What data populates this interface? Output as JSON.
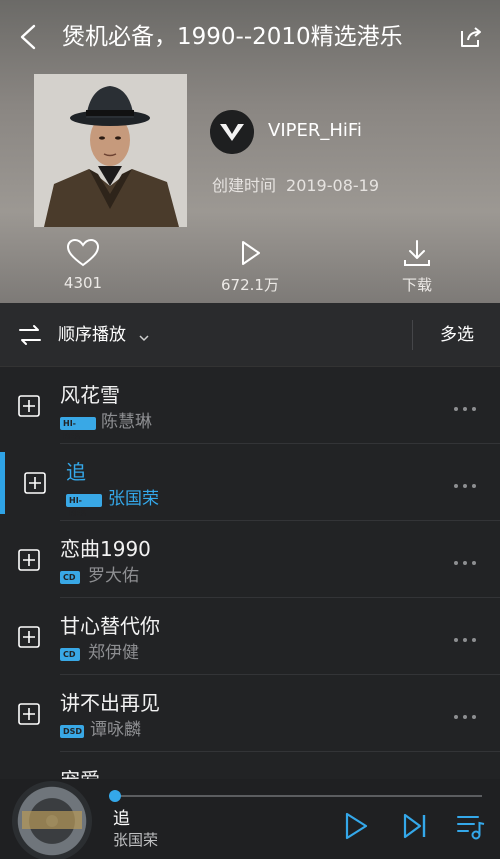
{
  "header": {
    "title": "煲机必备，1990--2010精选港乐",
    "creator": "VIPER_HiFi",
    "created_label": "创建时间",
    "created_date": "2019-08-19",
    "cover_desc": "Album cover photo of a man in a dark hat and coat"
  },
  "actions": {
    "like": "4301",
    "play": "672.1万",
    "download": "下载"
  },
  "controls": {
    "play_order": "顺序播放",
    "multi_select": "多选"
  },
  "songs": [
    {
      "title": "风花雪",
      "badge": "HI-RES",
      "artist": "陈慧琳"
    },
    {
      "title": "追",
      "badge": "HI-RES",
      "artist": "张国荣",
      "active": true
    },
    {
      "title": "恋曲1990",
      "badge": "CD",
      "artist": "罗大佑"
    },
    {
      "title": "甘心替代你",
      "badge": "CD",
      "artist": "郑伊健"
    },
    {
      "title": "讲不出再见",
      "badge": "DSD",
      "artist": "谭咏麟"
    },
    {
      "title": "宠爱",
      "partial": true
    }
  ],
  "player": {
    "title": "追",
    "artist": "张国荣"
  },
  "colors": {
    "accent": "#34a8ea",
    "bg": "#222325"
  }
}
